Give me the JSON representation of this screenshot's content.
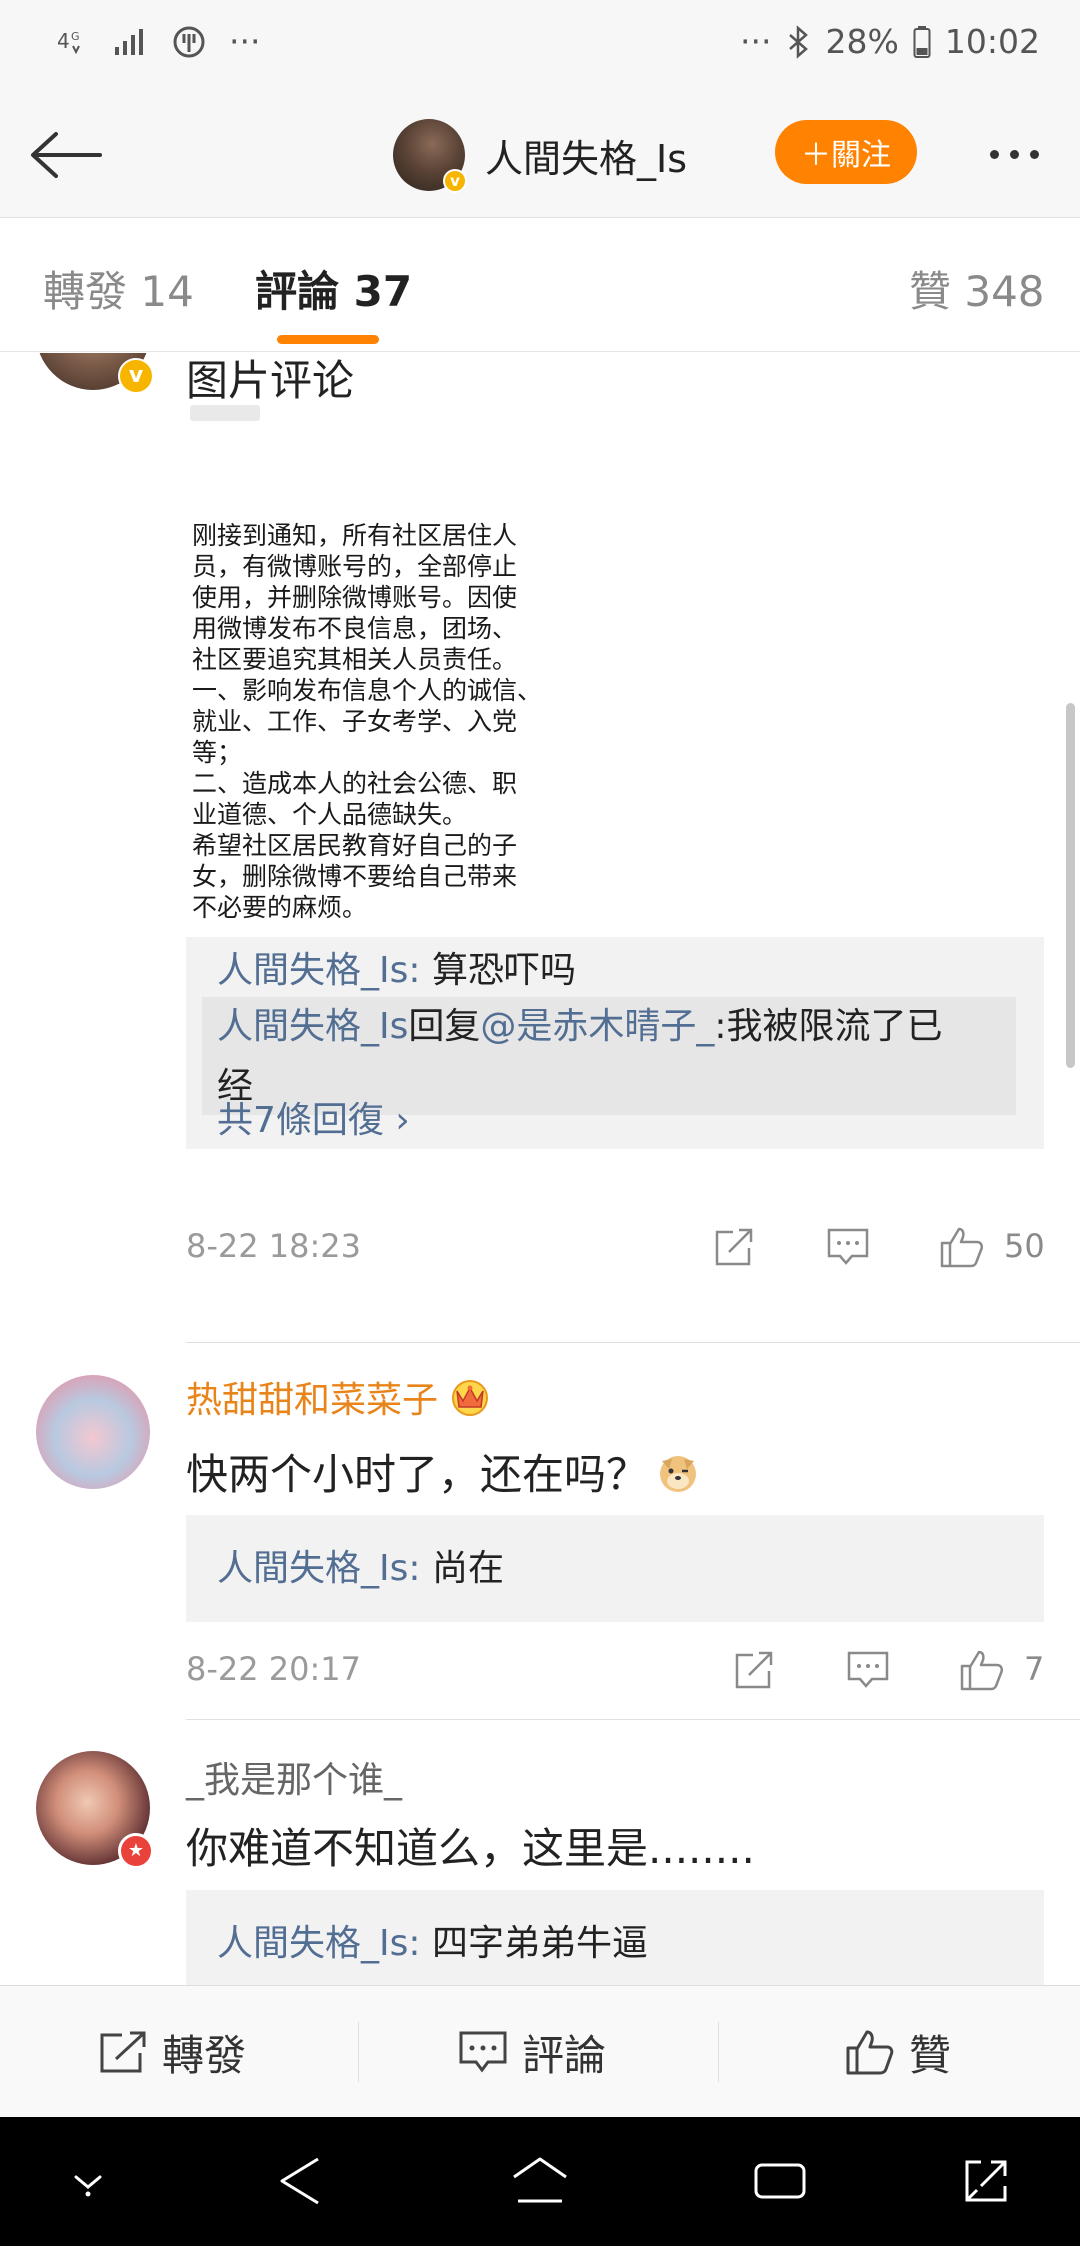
{
  "status_bar": {
    "network": "4G",
    "dots_left": "···",
    "dots_right": "···",
    "battery": "28%",
    "time": "10:02"
  },
  "header": {
    "user_name": "人間失格_Is",
    "follow_label": "＋關注"
  },
  "tabs": {
    "repost": "轉發 14",
    "comment": "評論 37",
    "like": "贊 348"
  },
  "comments": [
    {
      "text": "图片评论",
      "image_text": [
        "刚接到通知，所有社区居住人",
        "员，有微博账号的，全部停止",
        "使用，并删除微博账号。因使",
        "用微博发布不良信息，团场、",
        "社区要追究其相关人员责任。",
        "一、影响发布信息个人的诚信、",
        "就业、工作、子女考学、入党",
        "等；",
        "二、造成本人的社会公德、职",
        "业道德、个人品德缺失。",
        "希望社区居民教育好自己的子",
        "女，删除微博不要给自己带来",
        "不必要的麻烦。"
      ],
      "replies": [
        {
          "user": "人間失格_Is",
          "sep": ": ",
          "text": "算恐吓吗"
        },
        {
          "user": "人間失格_Is",
          "mid": "回复",
          "mention": "@是赤木晴子_",
          "text": ":我被限流了已",
          "text2": "经"
        }
      ],
      "more_replies": "共7條回復 ›",
      "date": "8-22 18:23",
      "likes": "50"
    },
    {
      "user": "热甜甜和菜菜子",
      "text": "快两个小时了，还在吗？",
      "replies": [
        {
          "user": "人間失格_Is",
          "sep": ": ",
          "text": "尚在"
        }
      ],
      "date": "8-22 20:17",
      "likes": "7"
    },
    {
      "user": "_我是那个谁_",
      "text": "你难道不知道么，这里是........",
      "replies": [
        {
          "user": "人間失格_Is",
          "sep": ": ",
          "text": "四字弟弟牛逼"
        }
      ]
    }
  ],
  "action_bar": {
    "repost": "轉發",
    "comment": "評論",
    "like": "贊"
  },
  "colors": {
    "accent": "#ff8200",
    "link_blue": "#526e93",
    "gold_name": "#e8841a"
  }
}
